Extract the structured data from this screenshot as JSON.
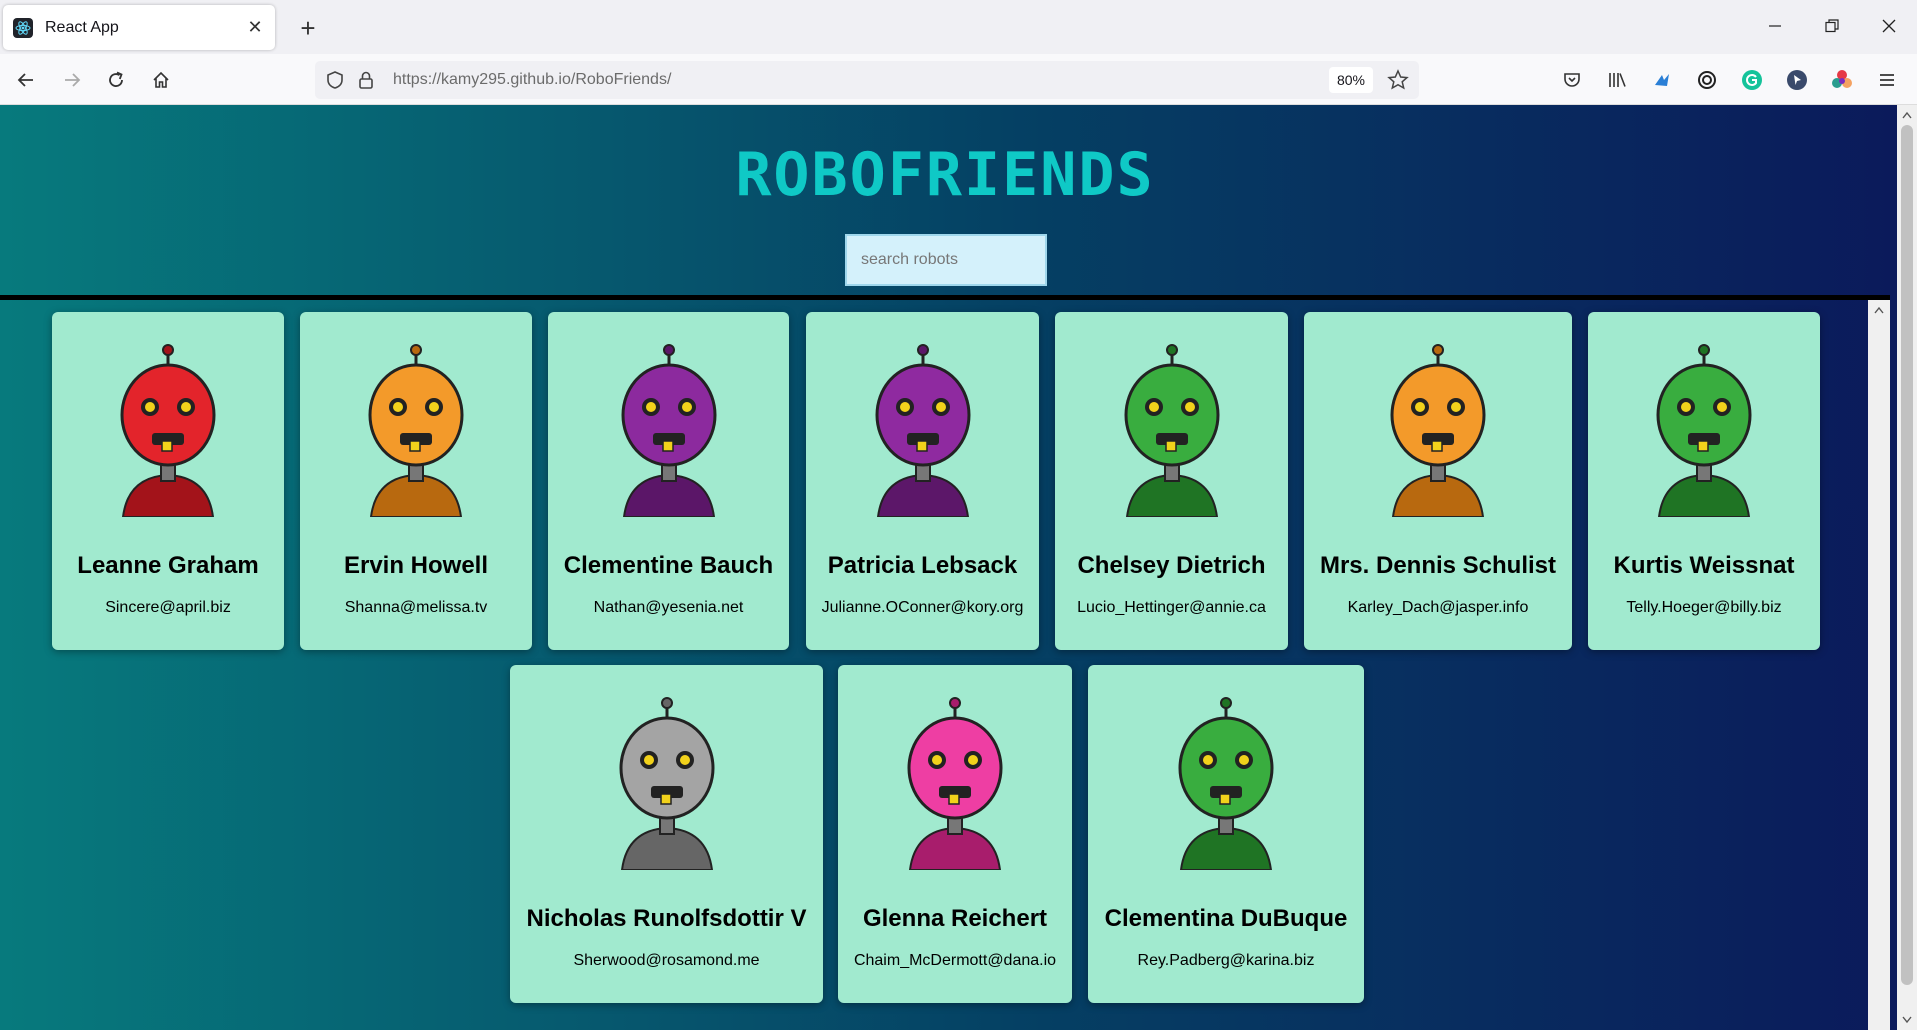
{
  "browser": {
    "tab_title": "React App",
    "url_host": "https://kamy295.github.io",
    "url_path": "/RoboFriends/",
    "zoom": "80%"
  },
  "app": {
    "title": "ROBOFRIENDS",
    "search_placeholder": "search robots"
  },
  "robots": [
    {
      "name": "Leanne Graham",
      "email": "Sincere@april.biz",
      "color": "#e3242b",
      "shade": "#a3131a"
    },
    {
      "name": "Ervin Howell",
      "email": "Shanna@melissa.tv",
      "color": "#f39a2a",
      "shade": "#b8690f"
    },
    {
      "name": "Clementine Bauch",
      "email": "Nathan@yesenia.net",
      "color": "#8c2a9e",
      "shade": "#5b1668"
    },
    {
      "name": "Patricia Lebsack",
      "email": "Julianne.OConner@kory.org",
      "color": "#8f2aa0",
      "shade": "#5c1769"
    },
    {
      "name": "Chelsey Dietrich",
      "email": "Lucio_Hettinger@annie.ca",
      "color": "#39ad3f",
      "shade": "#1f7424"
    },
    {
      "name": "Mrs. Dennis Schulist",
      "email": "Karley_Dach@jasper.info",
      "color": "#f39a2a",
      "shade": "#b8690f"
    },
    {
      "name": "Kurtis Weissnat",
      "email": "Telly.Hoeger@billy.biz",
      "color": "#39ad3f",
      "shade": "#1f7424"
    },
    {
      "name": "Nicholas Runolfsdottir V",
      "email": "Sherwood@rosamond.me",
      "color": "#a4a4a4",
      "shade": "#666666"
    },
    {
      "name": "Glenna Reichert",
      "email": "Chaim_McDermott@dana.io",
      "color": "#ee3ea3",
      "shade": "#a81d6c"
    },
    {
      "name": "Clementina DuBuque",
      "email": "Rey.Padberg@karina.biz",
      "color": "#39ad3f",
      "shade": "#1f7424"
    }
  ]
}
